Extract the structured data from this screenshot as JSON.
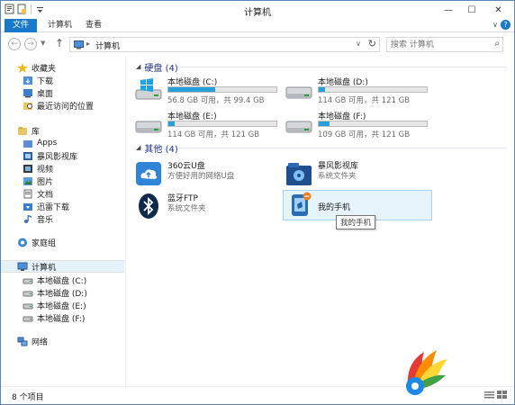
{
  "window": {
    "title": "计算机"
  },
  "quick_access": {
    "icons": [
      "properties-icon",
      "new-folder-icon",
      "customize-dropdown-icon"
    ]
  },
  "window_controls": {
    "minimize": "—",
    "maximize": "☐",
    "close": "✕"
  },
  "ribbon": {
    "tabs": [
      {
        "label": "文件"
      },
      {
        "label": "计算机"
      },
      {
        "label": "查看"
      }
    ],
    "expand_glyph": "∨",
    "help_glyph": "?"
  },
  "address": {
    "back": "←",
    "forward": "→",
    "up": "↑",
    "crumb_separator": "▸",
    "crumb": "计算机",
    "refresh": "↻",
    "search_placeholder": "搜索 计算机",
    "search_glyph": "⌕"
  },
  "nav": {
    "favorites_header": "收藏夹",
    "favorites": [
      {
        "label": "下载"
      },
      {
        "label": "桌面"
      },
      {
        "label": "最近访问的位置"
      }
    ],
    "libraries_header": "库",
    "libraries": [
      {
        "label": "Apps"
      },
      {
        "label": "暴风影视库"
      },
      {
        "label": "视频"
      },
      {
        "label": "图片"
      },
      {
        "label": "文档"
      },
      {
        "label": "迅雷下载"
      },
      {
        "label": "音乐"
      }
    ],
    "homegroup": "家庭组",
    "computer": "计算机",
    "drives": [
      {
        "label": "本地磁盘 (C:)"
      },
      {
        "label": "本地磁盘 (D:)"
      },
      {
        "label": "本地磁盘 (E:)"
      },
      {
        "label": "本地磁盘 (F:)"
      }
    ],
    "network": "网络"
  },
  "groups": {
    "drives_header": "硬盘 (4)",
    "others_header": "其他 (4)",
    "collapse_glyph": "◢"
  },
  "drives": [
    {
      "name": "本地磁盘 (C:)",
      "info": "56.8 GB 可用，共 99.4 GB",
      "used_fraction": 0.43,
      "icon": "windows-drive-icon"
    },
    {
      "name": "本地磁盘 (D:)",
      "info": "114 GB 可用，共 121 GB",
      "used_fraction": 0.06,
      "icon": "hard-drive-icon"
    },
    {
      "name": "本地磁盘 (E:)",
      "info": "114 GB 可用，共 121 GB",
      "used_fraction": 0.06,
      "icon": "hard-drive-icon"
    },
    {
      "name": "本地磁盘 (F:)",
      "info": "109 GB 可用，共 121 GB",
      "used_fraction": 0.1,
      "icon": "hard-drive-icon"
    }
  ],
  "others": [
    {
      "name": "360云U盘",
      "sub": "方便好用的网络U盘",
      "icon": "cloud-drive-icon"
    },
    {
      "name": "暴风影视库",
      "sub": "系统文件夹",
      "icon": "media-library-icon"
    },
    {
      "name": "蓝牙FTP",
      "sub": "系统文件夹",
      "icon": "bluetooth-icon"
    },
    {
      "name": "我的手机",
      "sub": "",
      "icon": "phone-icon"
    }
  ],
  "tooltip": "我的手机",
  "status": {
    "count_text": "8 个项目"
  },
  "colors": {
    "accent": "#1979ca",
    "bar_fill": "#26a0da",
    "header_text": "#1e3287"
  }
}
